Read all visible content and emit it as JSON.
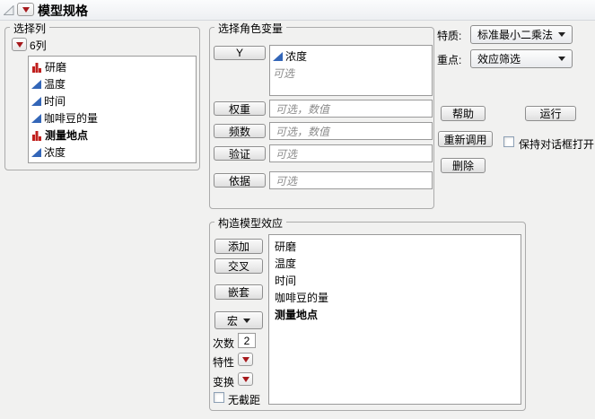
{
  "window": {
    "title": "模型规格"
  },
  "colors": {
    "accent_red": "#a6191c",
    "continuous_blue": "#3366b8",
    "nominal_red": "#c0201e",
    "background": "#f1f1f0"
  },
  "select_columns": {
    "label": "选择列",
    "header": "6列",
    "items": [
      {
        "name": "研磨",
        "type": "nominal"
      },
      {
        "name": "温度",
        "type": "continuous"
      },
      {
        "name": "时间",
        "type": "continuous"
      },
      {
        "name": "咖啡豆的量",
        "type": "continuous"
      },
      {
        "name": "测量地点",
        "type": "nominal"
      },
      {
        "name": "浓度",
        "type": "continuous"
      }
    ]
  },
  "roles": {
    "label": "选择角色变量",
    "y_button": "Y",
    "y_items": [
      {
        "name": "浓度",
        "type": "continuous"
      }
    ],
    "y_placeholder": "可选",
    "weight_button": "权重",
    "weight_placeholder": "可选，数值",
    "freq_button": "频数",
    "freq_placeholder": "可选，数值",
    "validation_button": "验证",
    "validation_placeholder": "可选",
    "by_button": "依据",
    "by_placeholder": "可选"
  },
  "personality": {
    "label": "特质:",
    "value": "标准最小二乘法"
  },
  "emphasis": {
    "label": "重点:",
    "value": "效应筛选"
  },
  "actions": {
    "help": "帮助",
    "run": "运行",
    "recall": "重新调用",
    "keep_dialog_open": "保持对话框打开",
    "remove": "删除"
  },
  "effects": {
    "label": "构造模型效应",
    "add": "添加",
    "cross": "交叉",
    "nest": "嵌套",
    "macros": "宏",
    "degree_label": "次数",
    "degree_value": "2",
    "attributes_label": "特性",
    "transform_label": "变换",
    "no_intercept_label": "无截距",
    "items": [
      {
        "name": "研磨",
        "bold": false
      },
      {
        "name": "温度",
        "bold": false
      },
      {
        "name": "时间",
        "bold": false
      },
      {
        "name": "咖啡豆的量",
        "bold": false
      },
      {
        "name": "测量地点",
        "bold": true
      }
    ]
  }
}
